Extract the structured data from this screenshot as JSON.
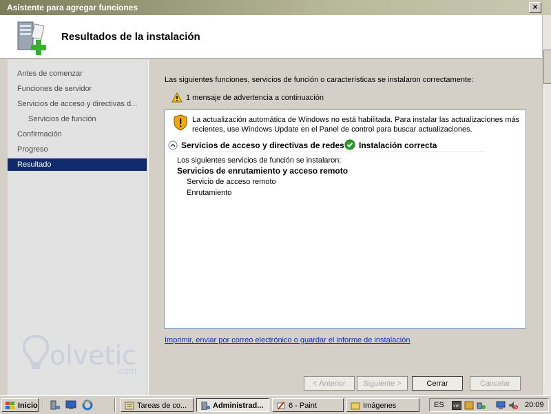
{
  "window": {
    "title": "Asistente para agregar funciones",
    "close_label": "×"
  },
  "header": {
    "title": "Resultados de la instalación"
  },
  "nav": {
    "items": [
      {
        "label": "Antes de comenzar"
      },
      {
        "label": "Funciones de servidor"
      },
      {
        "label": "Servicios de acceso y directivas d..."
      },
      {
        "label": "Servicios de función"
      },
      {
        "label": "Confirmación"
      },
      {
        "label": "Progreso"
      },
      {
        "label": "Resultado"
      }
    ]
  },
  "main": {
    "intro": "Las siguientes funciones, servicios de función o características se instalaron correctamente:",
    "warning_count": "1 mensaje de advertencia a continuación",
    "result": {
      "warning_line1": "La actualización automática de Windows no está habilitada. Para instalar las actualizaciones más",
      "warning_line2": "recientes, use Windows Update en el Panel de control para buscar actualizaciones.",
      "role_name": "Servicios de acceso y directivas de redes",
      "status": "Instalación correcta",
      "installed_intro": "Los siguientes servicios de función se instalaron:",
      "service_group": "Servicios de enrutamiento y acceso remoto",
      "services": [
        "Servicio de acceso remoto",
        "Enrutamiento"
      ]
    },
    "report_link": "Imprimir, enviar por correo electrónico o guardar el informe de instalación"
  },
  "logo": {
    "text": "olvetic",
    "suffix": ".com"
  },
  "buttons": {
    "back": "< Anterior",
    "next": "Siguiente >",
    "close": "Cerrar",
    "cancel": "Cancelar"
  },
  "taskbar": {
    "start": "Inicio",
    "tasks": [
      {
        "label": "Tareas de co..."
      },
      {
        "label": "Administrad..."
      },
      {
        "label": "6 - Paint"
      },
      {
        "label": "Imágenes"
      }
    ],
    "language": "ES",
    "clock": "20:09"
  },
  "colors": {
    "nav_active": "#112a6b",
    "link": "#0033cc",
    "ok_green": "#2e9e2e",
    "warn_yellow": "#f4c400"
  }
}
